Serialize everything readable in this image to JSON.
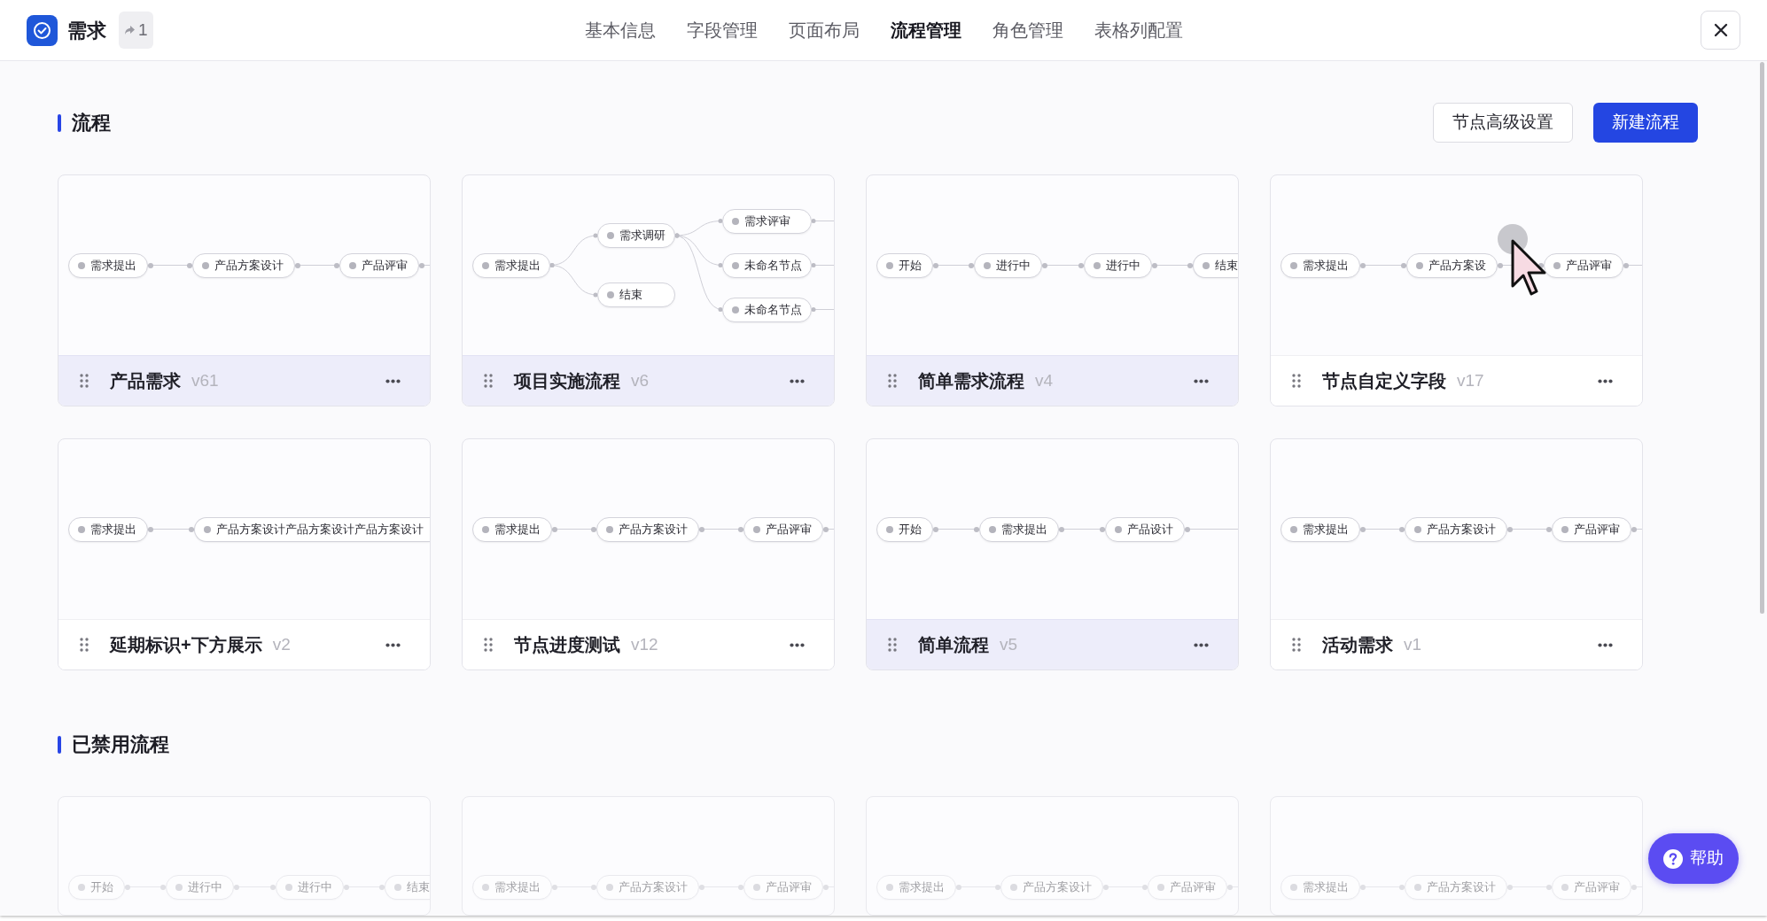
{
  "header": {
    "title": "需求",
    "share_count": "1",
    "tabs": [
      {
        "label": "基本信息",
        "selected": false
      },
      {
        "label": "字段管理",
        "selected": false
      },
      {
        "label": "页面布局",
        "selected": false
      },
      {
        "label": "流程管理",
        "selected": true
      },
      {
        "label": "角色管理",
        "selected": false
      },
      {
        "label": "表格列配置",
        "selected": false
      }
    ]
  },
  "sections": [
    {
      "title": "流程",
      "disabled": false,
      "buttons": [
        {
          "label": "节点高级设置",
          "kind": "secondary"
        },
        {
          "label": "新建流程",
          "kind": "primary"
        }
      ],
      "cards": [
        {
          "title": "产品需求",
          "version": "v61",
          "highlighted": true,
          "diagram": {
            "kind": "linear",
            "continues": true,
            "nodes": [
              {
                "label": "需求提出"
              },
              {
                "label": "产品方案设计"
              },
              {
                "label": "产品评审"
              }
            ]
          }
        },
        {
          "title": "项目实施流程",
          "version": "v6",
          "highlighted": true,
          "diagram": {
            "kind": "tree",
            "continues": true,
            "nodes": [
              {
                "label": "需求提出",
                "children": [
                  {
                    "label": "需求调研",
                    "children": [
                      {
                        "label": "需求评审"
                      },
                      {
                        "label": "未命名节点"
                      },
                      {
                        "label": "未命名节点"
                      }
                    ]
                  },
                  {
                    "label": "结束"
                  }
                ]
              }
            ]
          }
        },
        {
          "title": "简单需求流程",
          "version": "v4",
          "highlighted": true,
          "diagram": {
            "kind": "linear",
            "continues": false,
            "nodes": [
              {
                "label": "开始"
              },
              {
                "label": "进行中"
              },
              {
                "label": "进行中"
              },
              {
                "label": "结束"
              }
            ]
          }
        },
        {
          "title": "节点自定义字段",
          "version": "v17",
          "highlighted": false,
          "diagram": {
            "kind": "linear",
            "continues": true,
            "nodes": [
              {
                "label": "需求提出",
                "hovered": false
              },
              {
                "label": "产品方案设",
                "hovered": true
              },
              {
                "label": "产品评审",
                "hovered": false
              }
            ]
          }
        },
        {
          "title": "延期标识+下方展示",
          "version": "v2",
          "highlighted": false,
          "diagram": {
            "kind": "linear",
            "continues": false,
            "nodes": [
              {
                "label": "需求提出"
              },
              {
                "label": "产品方案设计产品方案设计产品方案设计"
              }
            ]
          }
        },
        {
          "title": "节点进度测试",
          "version": "v12",
          "highlighted": false,
          "diagram": {
            "kind": "linear",
            "continues": true,
            "nodes": [
              {
                "label": "需求提出"
              },
              {
                "label": "产品方案设计"
              },
              {
                "label": "产品评审"
              }
            ]
          }
        },
        {
          "title": "简单流程",
          "version": "v5",
          "highlighted": true,
          "diagram": {
            "kind": "linear",
            "continues": true,
            "nodes": [
              {
                "label": "开始"
              },
              {
                "label": "需求提出"
              },
              {
                "label": "产品设计"
              }
            ]
          }
        },
        {
          "title": "活动需求",
          "version": "v1",
          "highlighted": false,
          "diagram": {
            "kind": "linear",
            "continues": true,
            "nodes": [
              {
                "label": "需求提出"
              },
              {
                "label": "产品方案设计"
              },
              {
                "label": "产品评审"
              }
            ]
          }
        }
      ]
    },
    {
      "title": "已禁用流程",
      "disabled": true,
      "cards": [
        {
          "diagram": {
            "kind": "linear",
            "continues": false,
            "nodes": [
              {
                "label": "开始"
              },
              {
                "label": "进行中"
              },
              {
                "label": "进行中"
              },
              {
                "label": "结束"
              }
            ]
          }
        },
        {
          "diagram": {
            "kind": "linear",
            "continues": true,
            "nodes": [
              {
                "label": "需求提出"
              },
              {
                "label": "产品方案设计"
              },
              {
                "label": "产品评审"
              }
            ]
          }
        },
        {
          "diagram": {
            "kind": "linear",
            "continues": true,
            "nodes": [
              {
                "label": "需求提出"
              },
              {
                "label": "产品方案设计"
              },
              {
                "label": "产品评审"
              }
            ]
          }
        },
        {
          "diagram": {
            "kind": "linear",
            "continues": true,
            "nodes": [
              {
                "label": "需求提出"
              },
              {
                "label": "产品方案设计"
              },
              {
                "label": "产品评审"
              }
            ]
          }
        }
      ]
    }
  ],
  "help_button": {
    "label": "帮助"
  }
}
